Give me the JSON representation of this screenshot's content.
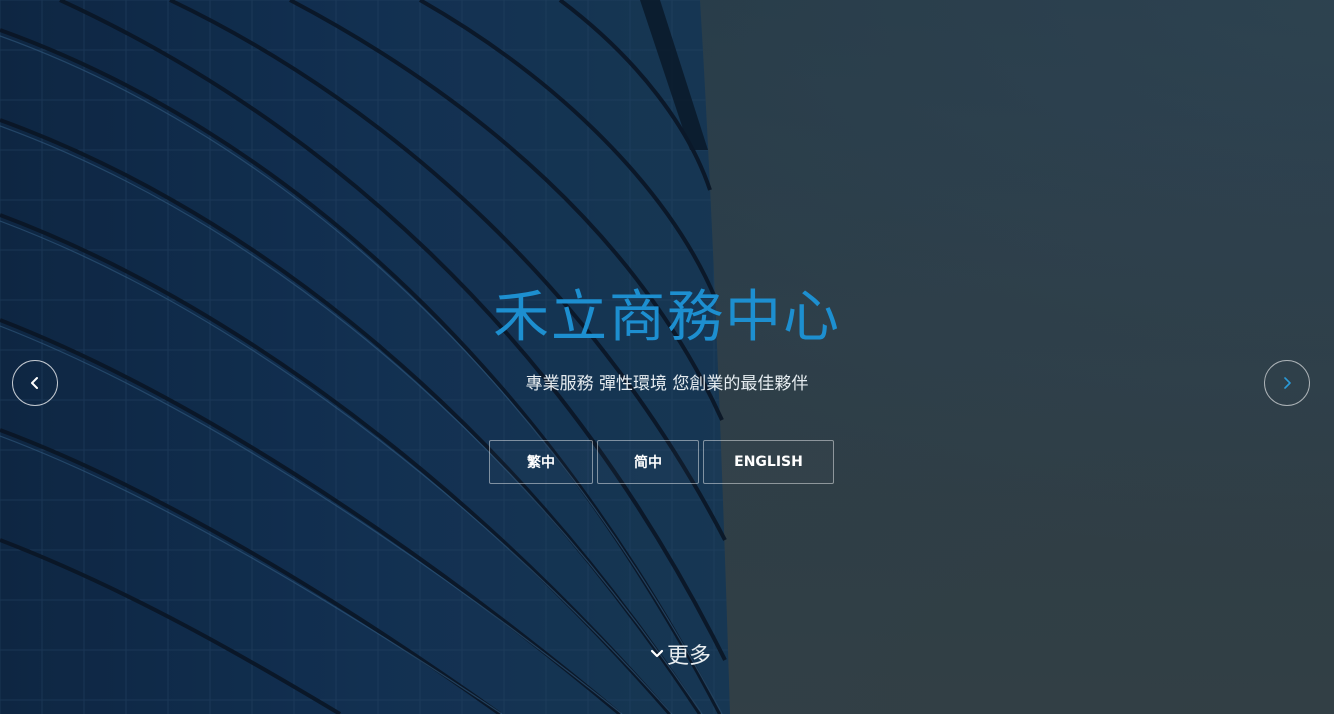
{
  "hero": {
    "title": "禾立商務中心",
    "subtitle": "專業服務 彈性環境 您創業的最佳夥伴",
    "languages": [
      {
        "label": "繁中"
      },
      {
        "label": "简中"
      },
      {
        "label": "ENGLISH"
      }
    ],
    "more_label": "更多"
  },
  "icons": {
    "prev": "chevron-left-icon",
    "next": "chevron-right-icon",
    "more": "chevron-down-icon"
  },
  "colors": {
    "title": "#1d8fd0",
    "next_arrow": "#2a9ad8",
    "text": "#e6ecf0"
  }
}
